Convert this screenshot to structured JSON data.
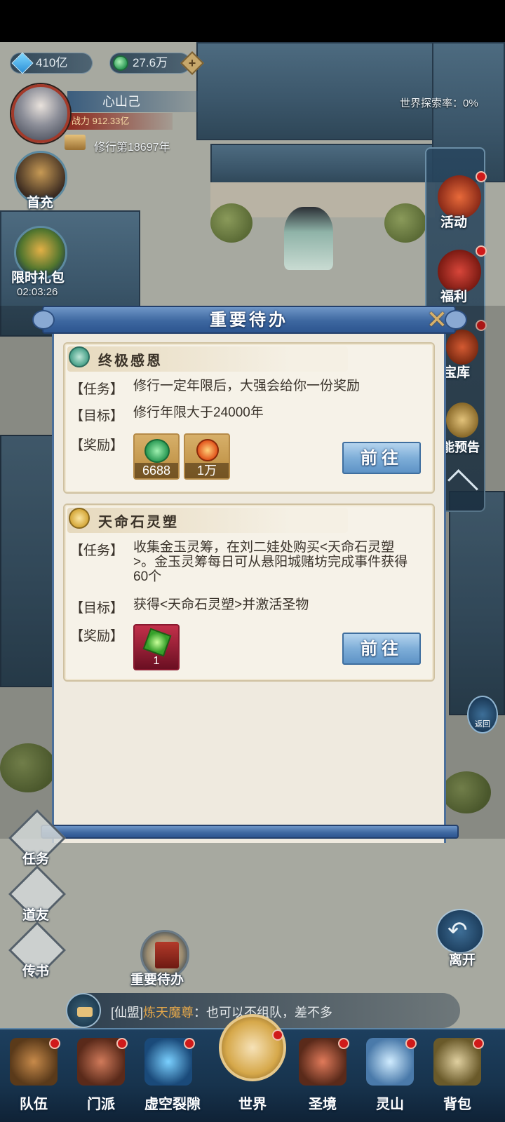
{
  "currency": {
    "spirit_stones": "410亿",
    "jade": "27.6万"
  },
  "player": {
    "name": "心山己",
    "power": "战力 912.33亿",
    "cultivation": "修行第18697年"
  },
  "left_menu": {
    "first_recharge": "首充",
    "limited_pack": "限时礼包",
    "timer": "02:03:26"
  },
  "explore_rate": "世界探索率：0%",
  "right_menu": {
    "items": [
      "活动",
      "福利",
      "宝库",
      "功能预告"
    ]
  },
  "modal": {
    "title": "重要待办",
    "close_icon": "close-x",
    "cards": [
      {
        "title": "终极感恩",
        "task_label": "【任务】",
        "task": "修行一定年限后，大强会给你一份奖励",
        "goal_label": "【目标】",
        "goal": "修行年限大于24000年",
        "reward_label": "【奖励】",
        "rewards": [
          {
            "icon": "jade-pendant",
            "qty": "6688"
          },
          {
            "icon": "fire-orb",
            "qty": "1万"
          }
        ],
        "go_label": "前往"
      },
      {
        "title": "天命石灵塑",
        "task_label": "【任务】",
        "task": "收集金玉灵筹，在刘二娃处购买<天命石灵塑>。金玉灵筹每日可从悬阳城赌坊完成事件获得60个",
        "goal_label": "【目标】",
        "goal": "获得<天命石灵塑>并激活圣物",
        "reward_label": "【奖励】",
        "rewards": [
          {
            "icon": "green-crystal",
            "qty": "1"
          }
        ],
        "go_label": "前往"
      }
    ]
  },
  "return_small": "返回",
  "side_menu": {
    "task": "任务",
    "dao": "道友",
    "letter": "传书",
    "todo": "重要待办",
    "leave": "离开"
  },
  "chat": {
    "channel": "[仙盟]",
    "name": "炼天魔尊",
    "message": "：也可以不组队，差不多"
  },
  "bottom_nav": [
    "队伍",
    "门派",
    "虚空裂隙",
    "世界",
    "圣境",
    "灵山",
    "背包"
  ],
  "colors": {
    "modal_header": "#3d67a0",
    "card_bg": "#f6f2e8",
    "go_button": "#7eaed8",
    "badge": "#d01a1a"
  }
}
